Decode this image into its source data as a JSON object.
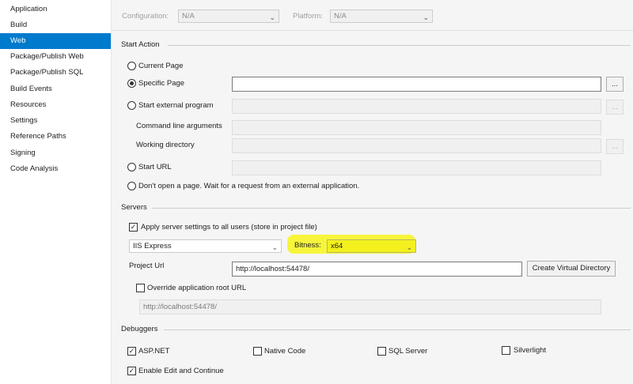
{
  "sidebar": {
    "items": [
      {
        "label": "Application",
        "active": false
      },
      {
        "label": "Build",
        "active": false
      },
      {
        "label": "Web",
        "active": true
      },
      {
        "label": "Package/Publish Web",
        "active": false
      },
      {
        "label": "Package/Publish SQL",
        "active": false
      },
      {
        "label": "Build Events",
        "active": false
      },
      {
        "label": "Resources",
        "active": false
      },
      {
        "label": "Settings",
        "active": false
      },
      {
        "label": "Reference Paths",
        "active": false
      },
      {
        "label": "Signing",
        "active": false
      },
      {
        "label": "Code Analysis",
        "active": false
      }
    ]
  },
  "config": {
    "configuration_label": "Configuration:",
    "configuration_value": "N/A",
    "platform_label": "Platform:",
    "platform_value": "N/A"
  },
  "start_action": {
    "title": "Start Action",
    "current_page": "Current Page",
    "specific_page": "Specific Page",
    "specific_page_value": "",
    "start_external": "Start external program",
    "command_line_args": "Command line arguments",
    "working_directory": "Working directory",
    "start_url": "Start URL",
    "dont_open": "Don't open a page.  Wait for a request from an external application.",
    "browse_label": "..."
  },
  "servers": {
    "title": "Servers",
    "apply_settings": "Apply server settings to all users (store in project file)",
    "server_value": "IIS Express",
    "bitness_label": "Bitness:",
    "bitness_value": "x64",
    "project_url_label": "Project Url",
    "project_url_value": "http://localhost:54478/",
    "create_vdir_button": "Create Virtual Directory",
    "override_root": "Override application root URL",
    "override_root_value": "http://localhost:54478/"
  },
  "debuggers": {
    "title": "Debuggers",
    "aspnet": "ASP.NET",
    "native_code": "Native Code",
    "sql_server": "SQL Server",
    "silverlight": "Silverlight",
    "edit_continue": "Enable Edit and Continue"
  },
  "colors": {
    "accent": "#007acc",
    "highlight": "#f7f51a"
  }
}
